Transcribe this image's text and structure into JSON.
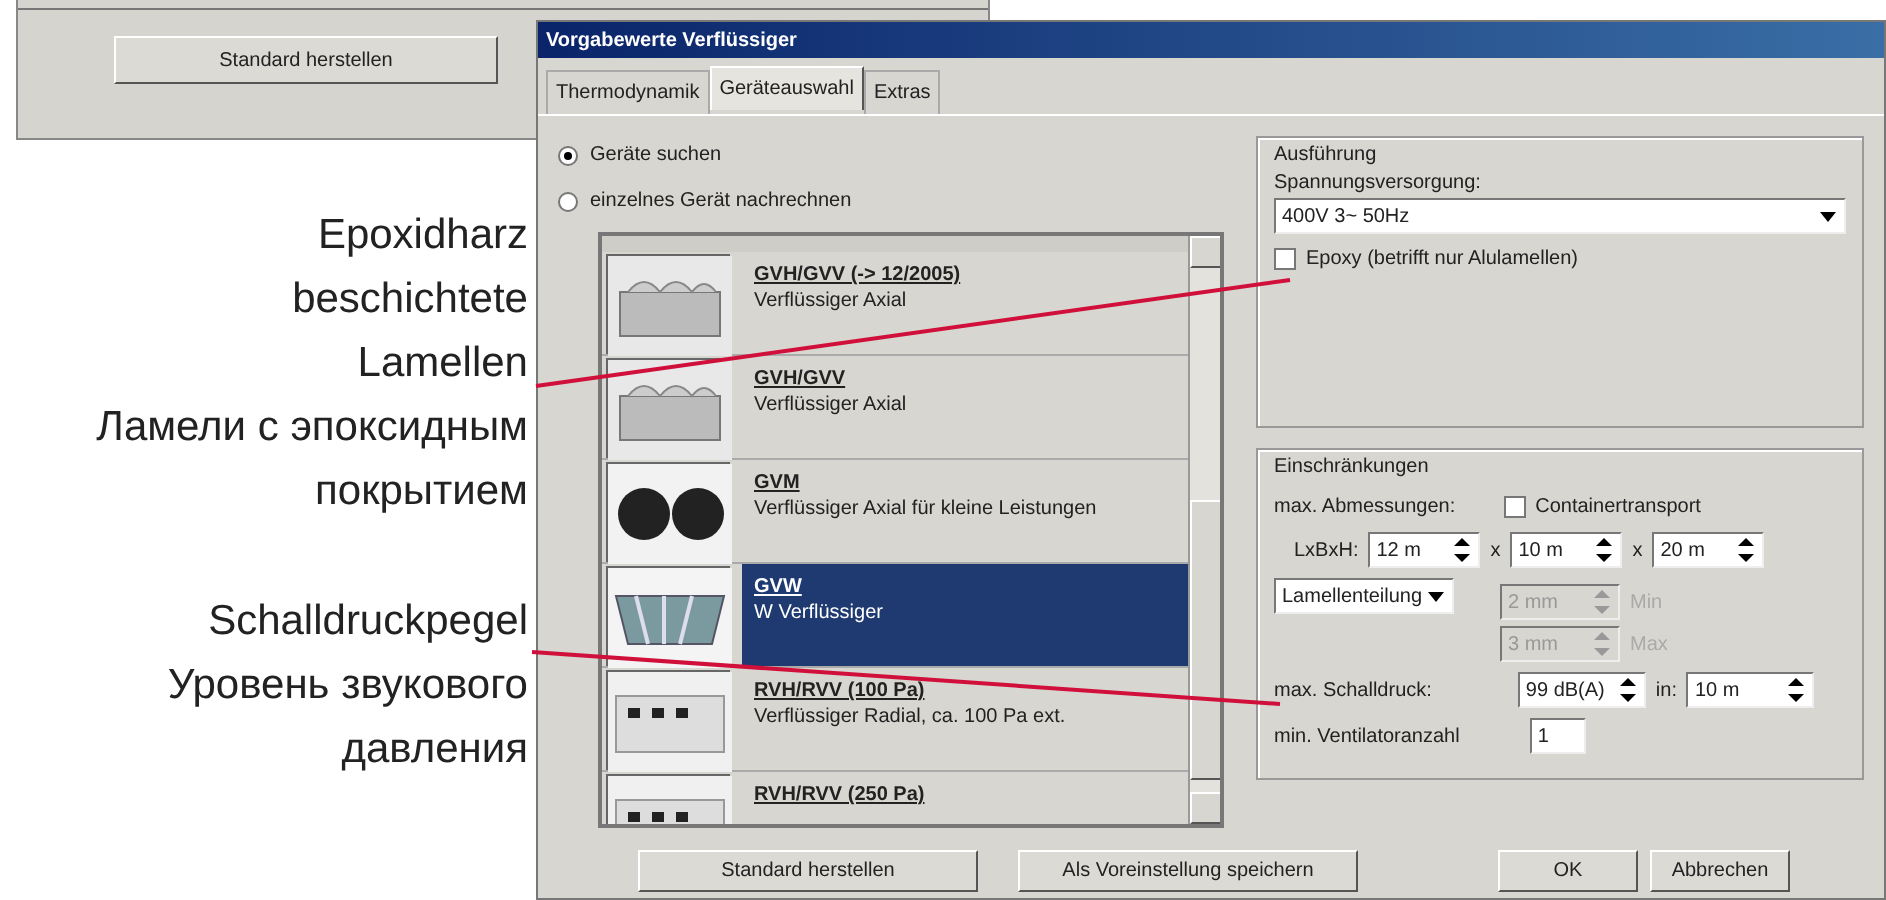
{
  "background_window": {
    "button": "Standard herstellen"
  },
  "dialog": {
    "title": "Vorgabewerte Verflüssiger",
    "tabs": [
      {
        "label": "Thermodynamik",
        "selected": false
      },
      {
        "label": "Geräteauswahl",
        "selected": true
      },
      {
        "label": "Extras",
        "selected": false
      }
    ],
    "mode_options": [
      {
        "label": "Geräte suchen",
        "selected": true
      },
      {
        "label": "einzelnes Gerät nachrechnen",
        "selected": false
      }
    ],
    "devices": [
      {
        "kind": "axial",
        "name": "GVH/GVV (-> 12/2005)",
        "description": "Verflüssiger Axial",
        "selected": false
      },
      {
        "kind": "axial",
        "name": "GVH/GVV",
        "description": "Verflüssiger Axial",
        "selected": false
      },
      {
        "kind": "fans",
        "name": "GVM",
        "description": "Verflüssiger Axial für kleine Leistungen",
        "selected": false
      },
      {
        "kind": "vshape",
        "name": "GVW",
        "description": "W Verflüssiger",
        "selected": true
      },
      {
        "kind": "radial",
        "name": "RVH/RVV (100 Pa)",
        "description": "Verflüssiger Radial, ca. 100 Pa ext.",
        "selected": false
      },
      {
        "kind": "radial",
        "name": "RVH/RVV (250 Pa)",
        "selected": false
      }
    ],
    "execution": {
      "title": "Ausführung",
      "supply_label": "Spannungsversorgung:",
      "supply_value": "400V 3~ 50Hz",
      "epoxy": {
        "label": "Epoxy (betrifft nur Alulamellen)",
        "checked": false
      }
    },
    "restrictions": {
      "title": "Einschränkungen",
      "max_dimensions_label": "max. Abmessungen:",
      "container": {
        "label": "Containertransport",
        "checked": false
      },
      "dimensions_label": "LxBxH:",
      "length": "12 m",
      "sep_1": "x",
      "width": "10 m",
      "sep_2": "x",
      "height": "20 m",
      "fin_select": "Lamellenteilung",
      "fin_min": {
        "value": "2 mm",
        "label": "Min",
        "disabled": true
      },
      "fin_max": {
        "value": "3 mm",
        "label": "Max",
        "disabled": true
      },
      "sound_label": "max. Schalldruck:",
      "sound_value": "99 dB(A)",
      "distance_label": "in:",
      "distance_value": "10 m",
      "fans_label": "min. Ventilatoranzahl",
      "fans_value": "1"
    },
    "buttons": [
      "Standard herstellen",
      "Als Voreinstellung speichern",
      "OK",
      "Abbrechen"
    ]
  },
  "annotations": [
    {
      "lines": [
        "Epoxidharz",
        "beschichtete",
        "Lamellen",
        "Ламели с эпоксидным",
        "покрытием"
      ]
    },
    {
      "lines": [
        "Schalldruckpegel",
        "Уровень звукового",
        "давления"
      ]
    }
  ]
}
